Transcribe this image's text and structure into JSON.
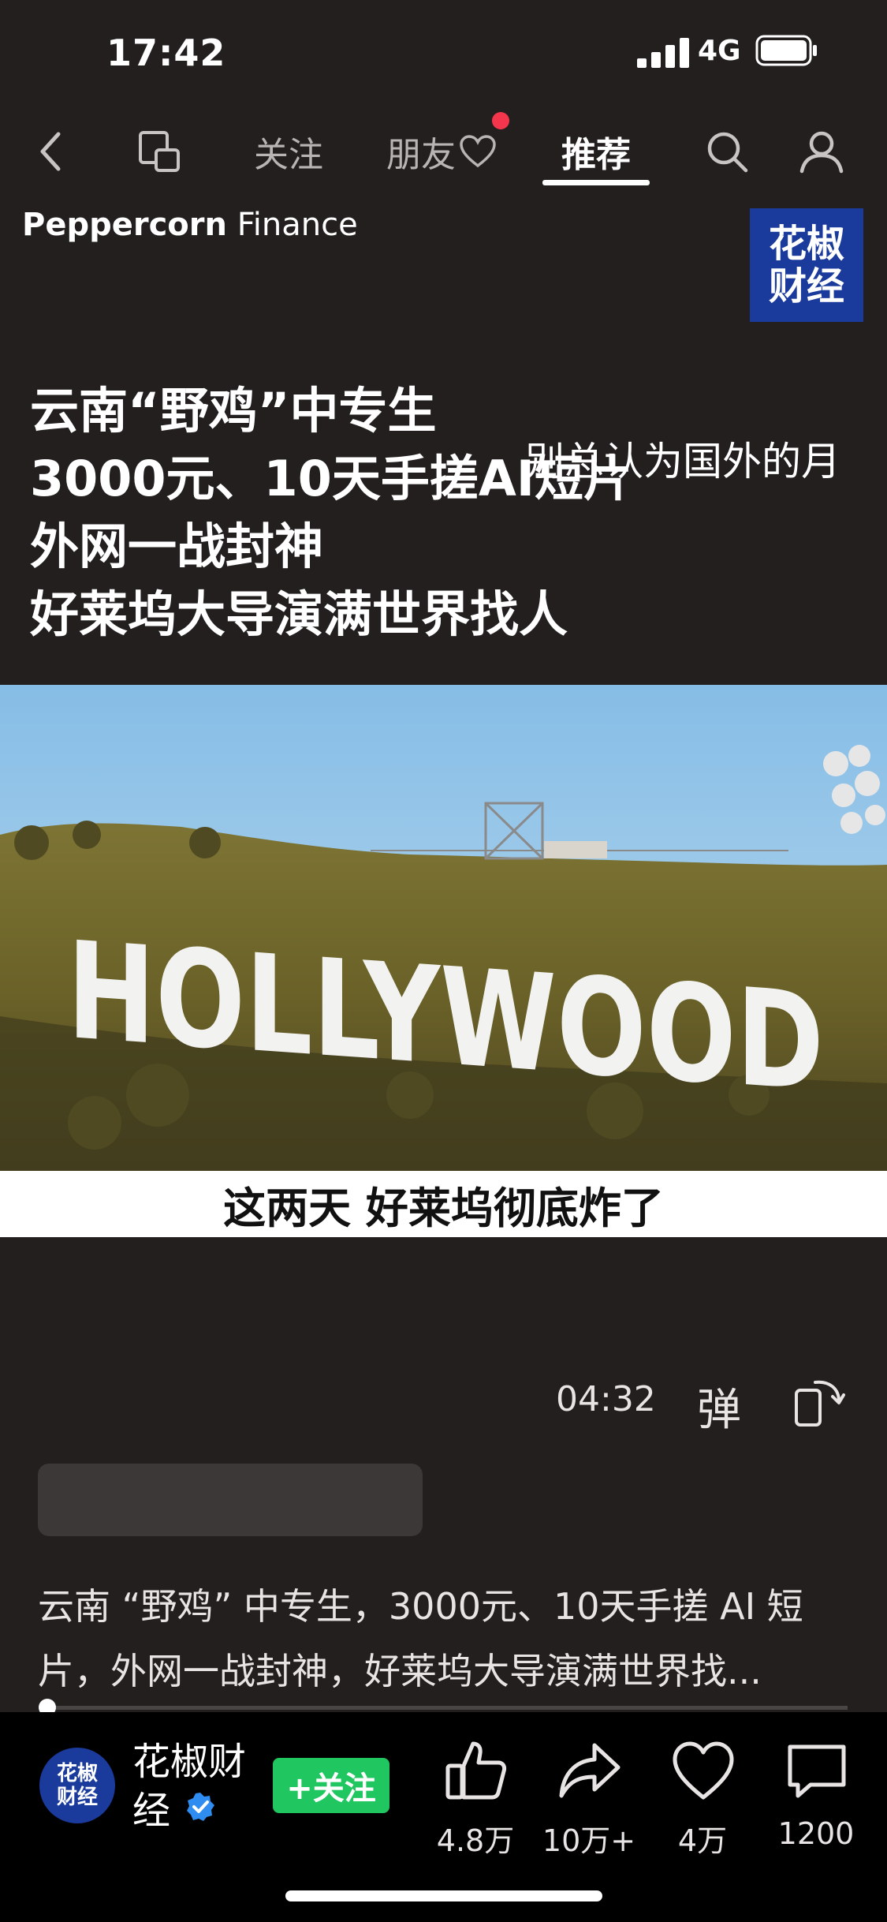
{
  "status_bar": {
    "time": "17:42",
    "network": "4G"
  },
  "nav": {
    "tabs": [
      {
        "label": "关注"
      },
      {
        "label": "朋友"
      },
      {
        "label": "推荐"
      }
    ],
    "active_tab": "推荐"
  },
  "video": {
    "brand_bold": "Peppercorn",
    "brand_light": "Finance",
    "logo_text": "花椒\n财经",
    "headline_lines": [
      "云南“野鸡”中专生",
      "3000元、10天手搓AI短片",
      "外网一战封神",
      "好莱坞大导演满世界找人"
    ],
    "danmaku": "别总认为国外的月",
    "sign_text": "HOLLYWOOD",
    "subtitle": "这两天 好莱坞彻底炸了",
    "duration": "04:32",
    "danmu_label": "弹",
    "description": "云南 “野鸡” 中专生，3000元、10天手搓 AI 短片，外网一战封神，好莱坞大导演满世界找...",
    "progress": 0.01
  },
  "footer": {
    "author": "花椒财经",
    "avatar_text": "花椒\n财经",
    "follow_label": "+关注",
    "actions": [
      {
        "icon": "thumbs-up-icon",
        "count": "4.8万"
      },
      {
        "icon": "share-icon",
        "count": "10万+"
      },
      {
        "icon": "heart-icon",
        "count": "4万"
      },
      {
        "icon": "comment-icon",
        "count": "1200"
      }
    ]
  },
  "colors": {
    "background": "#231f1f",
    "follow_green": "#20c660",
    "notify_red": "#f4364c",
    "logo_blue": "#1a3a9c"
  }
}
